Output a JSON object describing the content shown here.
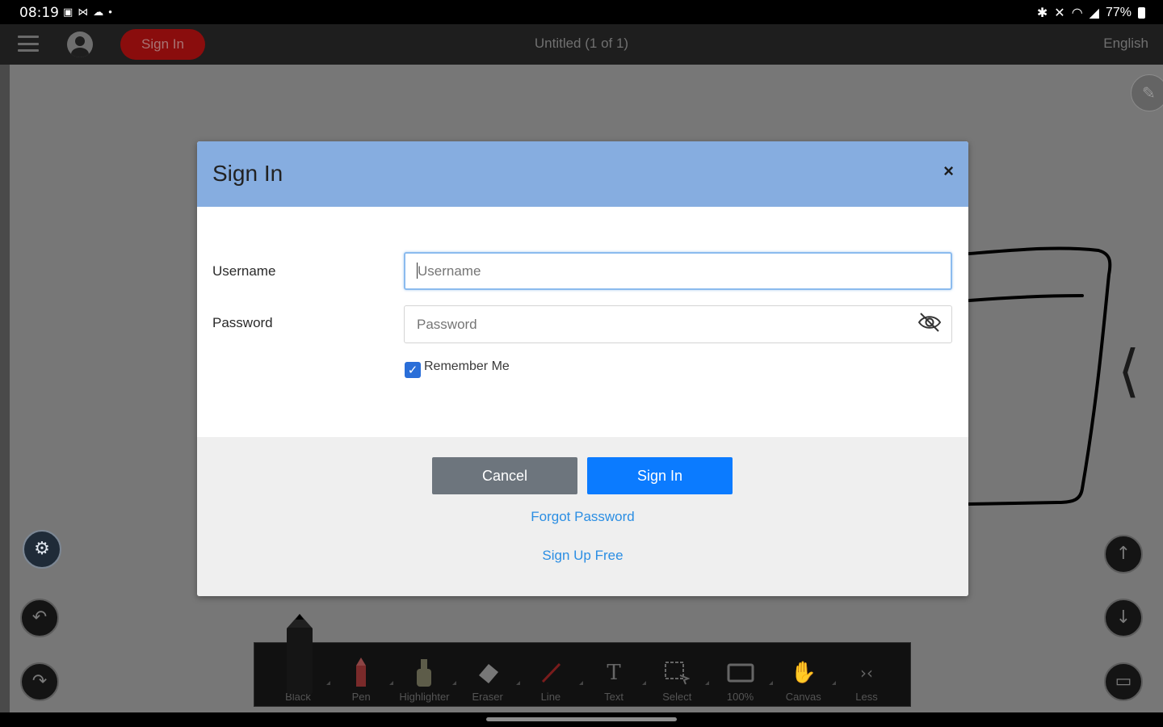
{
  "status_bar": {
    "time": "08:19",
    "left_icons": [
      "gallery-icon",
      "mail-icon",
      "cloud-icon",
      "dot-icon"
    ],
    "right_icons": [
      "bluetooth-icon",
      "mute-icon",
      "wifi-icon",
      "signal-icon"
    ],
    "battery_text": "77%"
  },
  "app_bar": {
    "signin_label": "Sign In",
    "doc_title": "Untitled (1 of 1)",
    "language": "English"
  },
  "dialog": {
    "title": "Sign In",
    "close_label": "×",
    "username_label": "Username",
    "username_placeholder": "Username",
    "username_value": "",
    "password_label": "Password",
    "password_placeholder": "Password",
    "password_value": "",
    "remember_label": "Remember Me",
    "remember_checked": true,
    "cancel_label": "Cancel",
    "signin_label": "Sign In",
    "forgot_label": "Forgot Password",
    "signup_label": "Sign Up Free"
  },
  "side_controls": {
    "settings_icon": "gear-icon",
    "undo_icon": "undo-icon",
    "redo_icon": "redo-icon",
    "up_icon": "arrow-up-icon",
    "down_icon": "arrow-down-icon",
    "keyboard_icon": "keyboard-icon"
  },
  "toolbar": {
    "tools": [
      {
        "label": "Black",
        "icon": "pencil-icon"
      },
      {
        "label": "Pen",
        "icon": "pen-icon"
      },
      {
        "label": "Highlighter",
        "icon": "highlighter-icon"
      },
      {
        "label": "Eraser",
        "icon": "eraser-icon"
      },
      {
        "label": "Line",
        "icon": "line-icon"
      },
      {
        "label": "Text",
        "icon": "text-icon"
      },
      {
        "label": "Select",
        "icon": "select-icon"
      },
      {
        "label": "100%",
        "icon": "zoom-rect-icon"
      },
      {
        "label": "Canvas",
        "icon": "hand-icon"
      },
      {
        "label": "Less",
        "icon": "collapse-icon"
      }
    ]
  },
  "colors": {
    "dialog_header": "#86ade0",
    "primary_button": "#0b7bff",
    "cancel_button": "#6d757d",
    "link": "#2b8ee3",
    "signin_pill": "#8a0d0d"
  }
}
